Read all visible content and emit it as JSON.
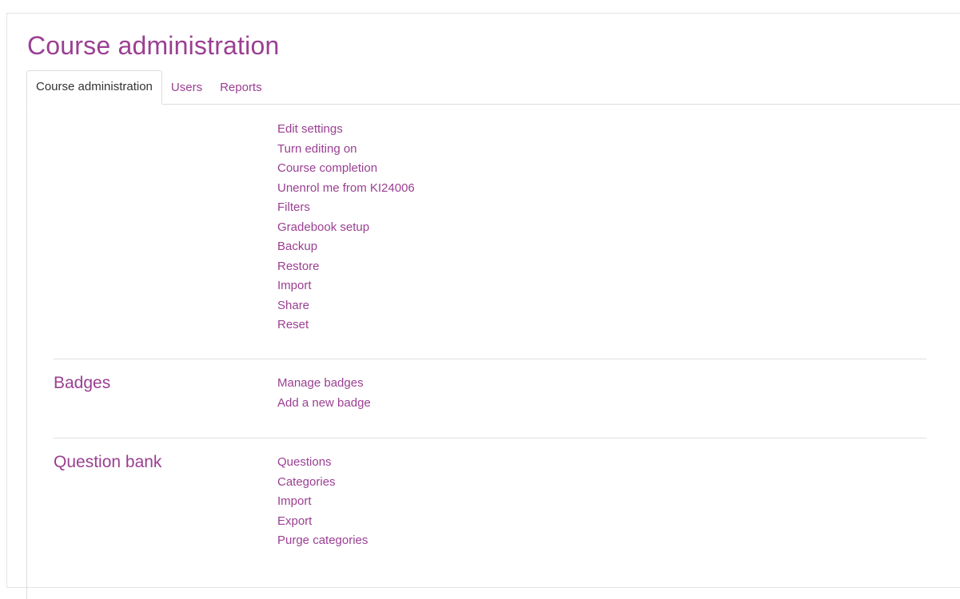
{
  "page_title": "Course administration",
  "tabs": [
    {
      "label": "Course administration",
      "active": true
    },
    {
      "label": "Users",
      "active": false
    },
    {
      "label": "Reports",
      "active": false
    }
  ],
  "sections": {
    "course": {
      "heading": "",
      "links": [
        "Edit settings",
        "Turn editing on",
        "Course completion",
        "Unenrol me from KI24006",
        "Filters",
        "Gradebook setup",
        "Backup",
        "Restore",
        "Import",
        "Share",
        "Reset"
      ]
    },
    "badges": {
      "heading": "Badges",
      "links": [
        "Manage badges",
        "Add a new badge"
      ]
    },
    "question_bank": {
      "heading": "Question bank",
      "links": [
        "Questions",
        "Categories",
        "Import",
        "Export",
        "Purge categories"
      ]
    }
  },
  "colors": {
    "accent": "#9a3f92",
    "text": "#333333",
    "border": "#dddddd"
  }
}
